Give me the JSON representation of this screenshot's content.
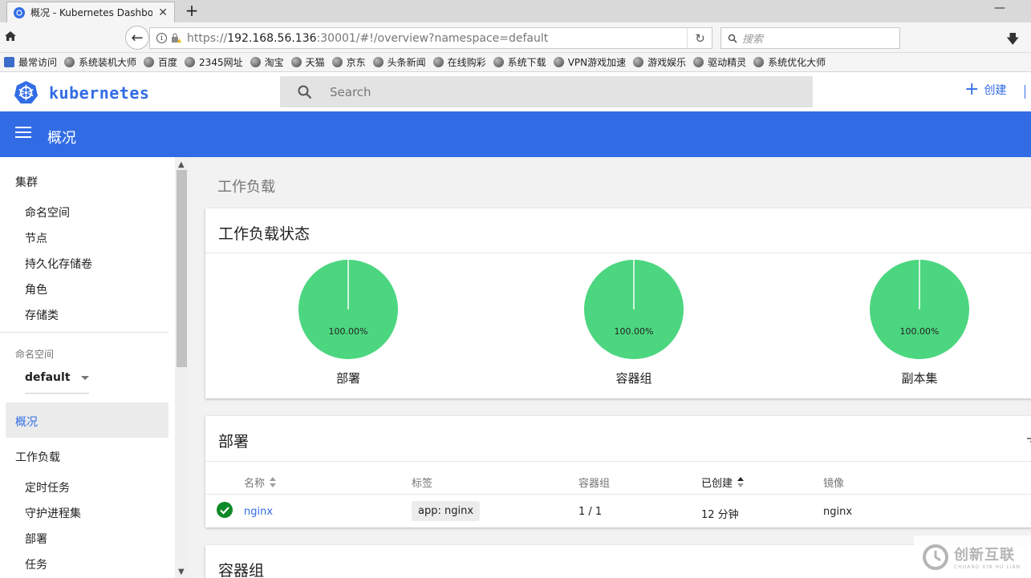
{
  "browser": {
    "tab_title": "概况 - Kubernetes Dashbo",
    "url_scheme": "https://",
    "url_host": "192.168.56.136",
    "url_rest": ":30001/#!/overview?namespace=default",
    "web_search_placeholder": "搜索",
    "bookmarks": [
      "最常访问",
      "系统装机大师",
      "百度",
      "2345网址",
      "淘宝",
      "天猫",
      "京东",
      "头条新闻",
      "在线购彩",
      "系统下载",
      "VPN游戏加速",
      "游戏娱乐",
      "驱动精灵",
      "系统优化大师"
    ]
  },
  "app": {
    "logo_text": "kubernetes",
    "search_placeholder": "Search",
    "create_label": "创建",
    "header_title": "概况"
  },
  "sidebar": {
    "cluster_section": "集群",
    "cluster_items": [
      "命名空间",
      "节点",
      "持久化存储卷",
      "角色",
      "存储类"
    ],
    "namespace_label": "命名空间",
    "namespace_value": "default",
    "overview": "概况",
    "workloads_section": "工作负载",
    "workload_items": [
      "定时任务",
      "守护进程集",
      "部署",
      "任务"
    ]
  },
  "main": {
    "title": "工作负载",
    "status_card": {
      "title": "工作负载状态",
      "charts": [
        {
          "label": "部署",
          "percent_text": "100.00%",
          "value": 100.0,
          "color": "#4cd680"
        },
        {
          "label": "容器组",
          "percent_text": "100.00%",
          "value": 100.0,
          "color": "#4cd680"
        },
        {
          "label": "副本集",
          "percent_text": "100.00%",
          "value": 100.0,
          "color": "#4cd680"
        }
      ]
    },
    "deployments_card": {
      "title": "部署",
      "columns": [
        "名称",
        "标签",
        "容器组",
        "已创建",
        "镜像"
      ],
      "rows": [
        {
          "status": "running",
          "name": "nginx",
          "label": "app: nginx",
          "pods": "1 / 1",
          "created": "12 分钟",
          "image": "nginx"
        }
      ]
    },
    "pods_card": {
      "title": "容器组"
    }
  },
  "watermark": {
    "cn": "创新互联",
    "en": "CHUANG XIN HU LIAN"
  },
  "colors": {
    "brand": "#326ce5",
    "ok": "#0f8a28",
    "pie_green": "#4cd680"
  }
}
